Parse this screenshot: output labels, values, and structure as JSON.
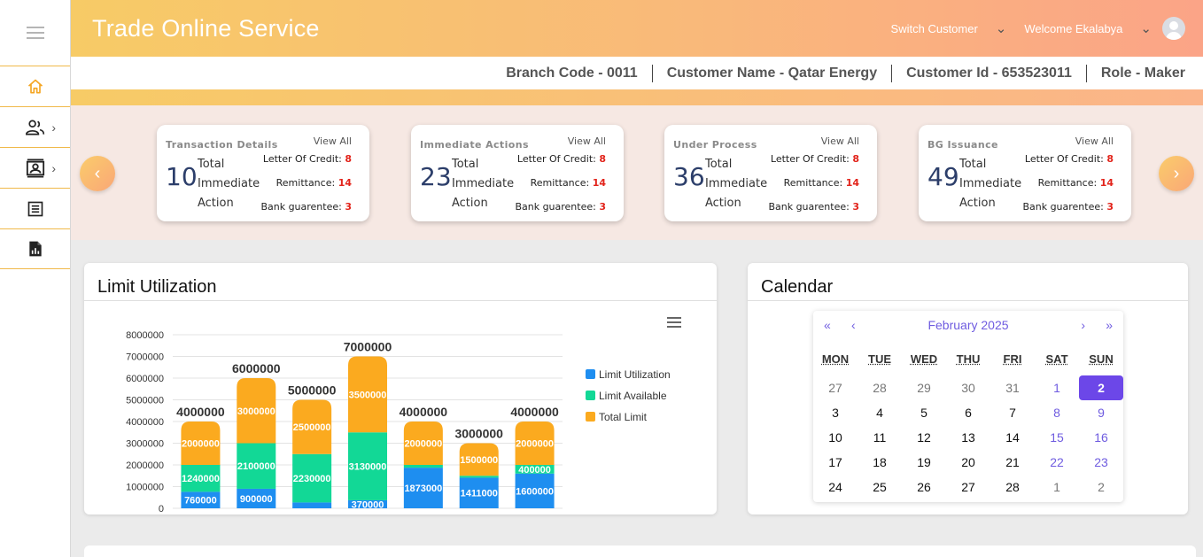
{
  "header": {
    "app_title": "Trade Online Service",
    "switch_customer": "Switch Customer",
    "welcome": "Welcome Ekalabya"
  },
  "info_bar": {
    "branch_code": "Branch Code - 0011",
    "customer_name": "Customer Name - Qatar Energy",
    "customer_id": "Customer Id - 653523011",
    "role": "Role - Maker"
  },
  "sidebar": {
    "items": [
      {
        "icon": "home-icon"
      },
      {
        "icon": "users-icon"
      },
      {
        "icon": "id-card-icon"
      },
      {
        "icon": "document-list-icon"
      },
      {
        "icon": "report-icon"
      }
    ]
  },
  "summary_cards": [
    {
      "title": "Transaction Details",
      "view_all": "View All",
      "number": "10",
      "label": "Total Immediate Action",
      "loc_label": "Letter Of Credit:",
      "loc": "8",
      "rem_label": "Remittance:",
      "rem": "14",
      "bg_label": "Bank guarentee:",
      "bg": "3"
    },
    {
      "title": "Immediate Actions",
      "view_all": "View All",
      "number": "23",
      "label": "Total Immediate Action",
      "loc_label": "Letter Of Credit:",
      "loc": "8",
      "rem_label": "Remittance:",
      "rem": "14",
      "bg_label": "Bank guarentee:",
      "bg": "3"
    },
    {
      "title": "Under Process",
      "view_all": "View All",
      "number": "36",
      "label": "Total Immediate Action",
      "loc_label": "Letter Of Credit:",
      "loc": "8",
      "rem_label": "Remittance:",
      "rem": "14",
      "bg_label": "Bank guarentee:",
      "bg": "3"
    },
    {
      "title": "BG Issuance",
      "view_all": "View All",
      "number": "49",
      "label": "Total Immediate Action",
      "loc_label": "Letter Of Credit:",
      "loc": "8",
      "rem_label": "Remittance:",
      "rem": "14",
      "bg_label": "Bank guarentee:",
      "bg": "3"
    }
  ],
  "limit_panel": {
    "title": "Limit Utilization"
  },
  "chart_data": {
    "type": "bar",
    "stacked": true,
    "ylim": [
      0,
      8000000
    ],
    "yticks": [
      "0",
      "1000000",
      "2000000",
      "3000000",
      "4000000",
      "5000000",
      "6000000",
      "7000000",
      "8000000"
    ],
    "totals": [
      4000000,
      6000000,
      5000000,
      7000000,
      4000000,
      3000000,
      4000000
    ],
    "series": [
      {
        "name": "Limit Utilization",
        "color": "#1e8ef0",
        "values": [
          760000,
          900000,
          270000,
          370000,
          1873000,
          1411000,
          1600000
        ]
      },
      {
        "name": "Limit Available",
        "color": "#12d896",
        "values": [
          1240000,
          2100000,
          2230000,
          3130000,
          127000,
          89000,
          400000
        ]
      },
      {
        "name": "Total Limit",
        "color": "#fbaa1f",
        "values": [
          2000000,
          3000000,
          2500000,
          3500000,
          2000000,
          1500000,
          2000000
        ]
      }
    ],
    "data_labels": [
      [
        "760000",
        "1240000",
        "2000000"
      ],
      [
        "900000",
        "2100000",
        "3000000"
      ],
      [
        "",
        "2230000",
        "2500000"
      ],
      [
        "370000",
        "3130000",
        "3500000"
      ],
      [
        "1873000",
        "",
        "2000000"
      ],
      [
        "1411000",
        "",
        "1500000"
      ],
      [
        "1600000",
        "400000",
        "2000000"
      ]
    ],
    "grid": true,
    "legend": "right"
  },
  "calendar": {
    "title": "Calendar",
    "month": "February 2025",
    "nav": {
      "first": "«",
      "prev": "‹",
      "next": "›",
      "last": "»"
    },
    "weekdays": [
      "MON",
      "TUE",
      "WED",
      "THU",
      "FRI",
      "SAT",
      "SUN"
    ],
    "weeks": [
      [
        "27",
        "28",
        "29",
        "30",
        "31",
        "1",
        "2"
      ],
      [
        "3",
        "4",
        "5",
        "6",
        "7",
        "8",
        "9"
      ],
      [
        "10",
        "11",
        "12",
        "13",
        "14",
        "15",
        "16"
      ],
      [
        "17",
        "18",
        "19",
        "20",
        "21",
        "22",
        "23"
      ],
      [
        "24",
        "25",
        "26",
        "27",
        "28",
        "1",
        "2"
      ]
    ],
    "selected": "2"
  },
  "colors": {
    "accent": "#f7cb66",
    "brand_gradient_end": "#fba487",
    "calendar_accent": "#6c47e8",
    "alert": "#e2231a"
  }
}
